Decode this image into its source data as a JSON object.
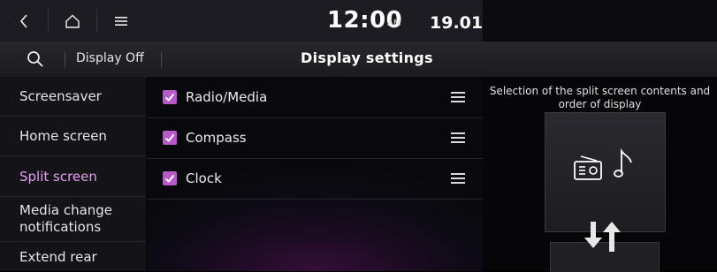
{
  "status_bar": {
    "time": "12:00",
    "ampm": "AM",
    "date": "19.01",
    "icons": [
      "back-icon",
      "home-icon",
      "menu-icon"
    ]
  },
  "header": {
    "display_off": "Display Off",
    "title": "Display settings"
  },
  "sidebar": {
    "items": [
      {
        "label": "Screensaver",
        "active": false
      },
      {
        "label": "Home screen",
        "active": false
      },
      {
        "label": "Split screen",
        "active": true
      },
      {
        "label": "Media change notifications",
        "active": false
      },
      {
        "label": "Extend rear",
        "active": false
      }
    ]
  },
  "split_screen_options": [
    {
      "label": "Radio/Media",
      "checked": true
    },
    {
      "label": "Compass",
      "checked": true
    },
    {
      "label": "Clock",
      "checked": true
    }
  ],
  "info_panel": {
    "hint": "Selection of the split screen contents and order of display",
    "preview_icons": [
      "radio-icon",
      "music-note-icon",
      "swap-arrows-icon"
    ]
  },
  "colors": {
    "accent": "#e2a0ee",
    "checkbox": "#b65ac8",
    "background": "#000000"
  }
}
